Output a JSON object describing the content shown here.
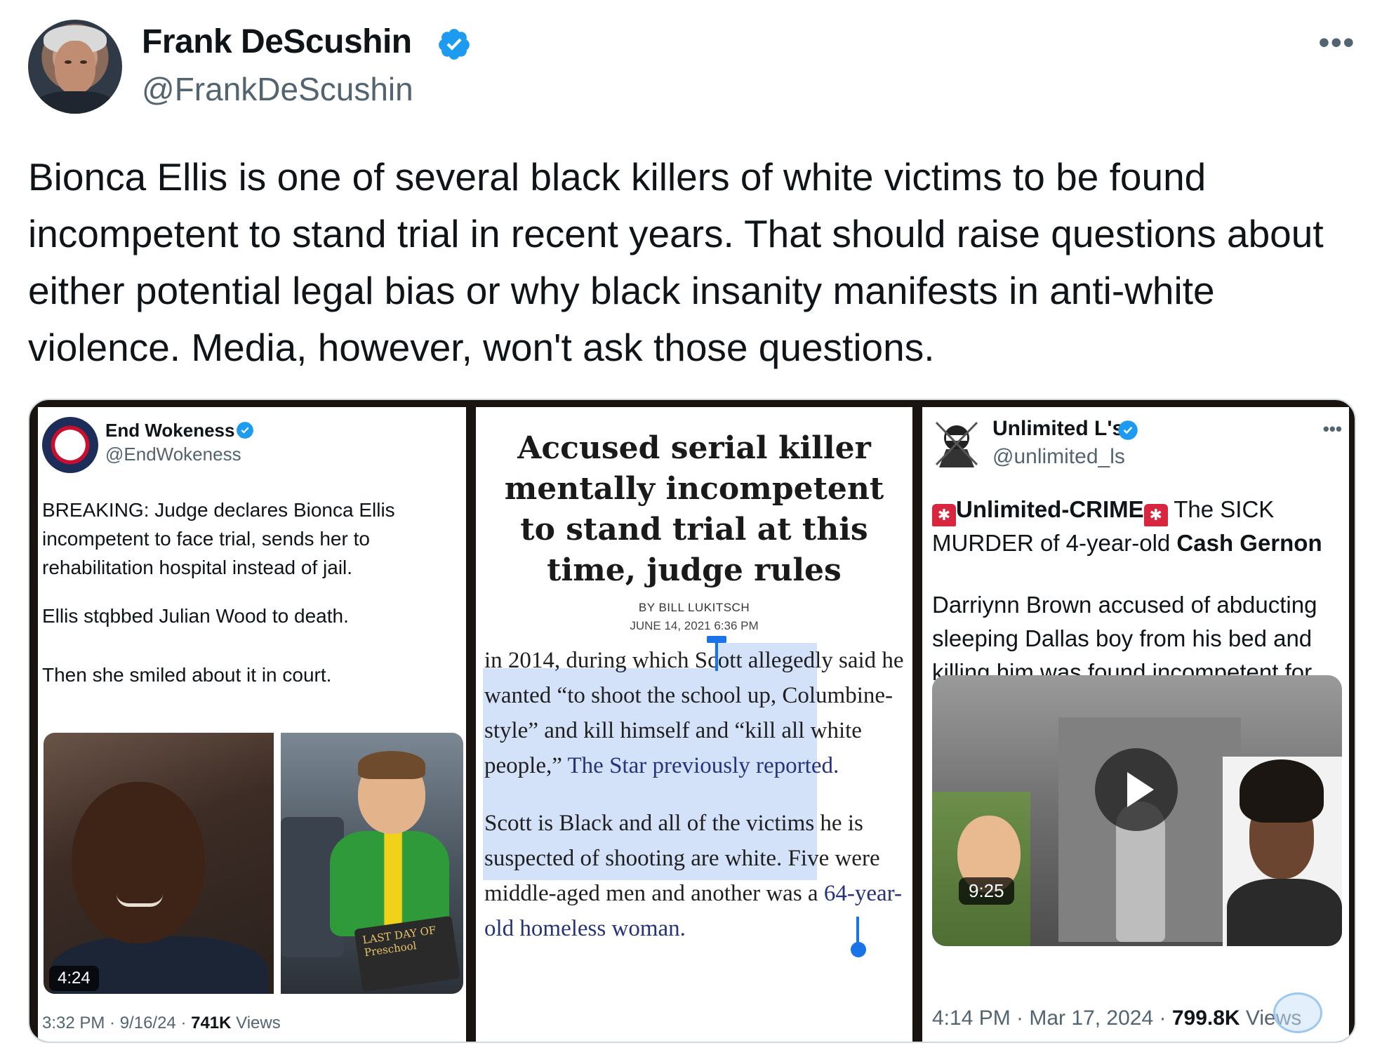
{
  "tweet": {
    "display_name": "Frank DeScushin",
    "handle": "@FrankDeScushin",
    "more_label": "•••",
    "text": "Bionca Ellis is one of several black killers of white victims to be found incompetent to stand trial in recent years. That should raise questions about either potential legal bias or why black insanity manifests in anti-white violence. Media, however, won't ask those questions.",
    "verified_color": "#1d9bf0"
  },
  "media": {
    "panel1": {
      "display_name": "End Wokeness",
      "handle": "@EndWokeness",
      "body": "BREAKING: Judge declares Bionca Ellis incompetent to face trial, sends her to rehabilitation hospital instead of jail.",
      "line2": "Ellis stqbbed Julian Wood to death.",
      "line3": "Then she smiled about it in court.",
      "video_duration": "4:24",
      "sign_text": "LAST DAY OF Preschool",
      "footer_time": "3:32 PM · 9/16/24 · ",
      "footer_views": "741K",
      "footer_views_label": " Views"
    },
    "panel2": {
      "headline": "Accused serial killer mentally incompetent to stand trial at this time, judge rules",
      "byline": "BY BILL LUKITSCH",
      "date": "JUNE 14, 2021 6:36 PM",
      "para1_a": "in 2014, during which Scott allegedly said he wanted “to shoot the school up, Columbine-style” and kill himself and “kill all white people,” ",
      "para1_link": "The Star previously reported.",
      "para2_a": "Scott is Black and all of the victims he is suspected of shooting are white. Five were middle-aged men and another was a ",
      "para2_link": "64-year-old homeless woman.",
      "link_color": "#26327a",
      "highlight_color": "#d4e2f9"
    },
    "panel3": {
      "display_name": "Unlimited L's",
      "handle": "@unlimited_ls",
      "more_label": "•••",
      "headline_bold": "Unlimited-CRIME",
      "headline_rest": " The SICK MURDER of 4-year-old ",
      "headline_name": "Cash Gernon",
      "body": "Darriynn Brown accused of abducting sleeping Dallas boy from his bed and killing him was found incompetent for trial",
      "video_duration": "9:25",
      "footer_time": "4:14 PM · Mar 17, 2024 · ",
      "footer_views": "799.8K",
      "footer_views_label": " Views",
      "siren_color": "#d7263d"
    }
  }
}
